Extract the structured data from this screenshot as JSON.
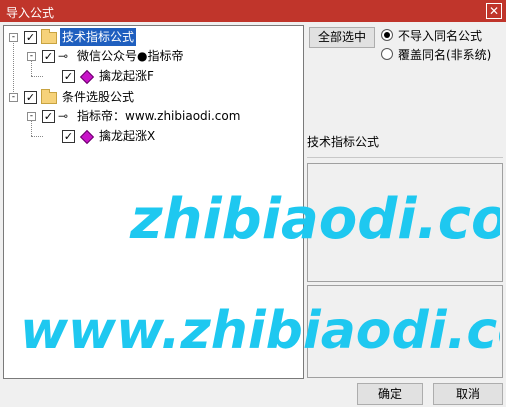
{
  "window": {
    "title": "导入公式",
    "close_glyph": "✕"
  },
  "tree": {
    "nodes": [
      {
        "label": "技术指标公式",
        "checked": true,
        "selected": true,
        "icon": "folder-icon"
      },
      {
        "label": "微信公众号●指标帝",
        "checked": true,
        "icon": "key-icon"
      },
      {
        "label": "擒龙起涨F",
        "checked": true,
        "icon": "formula-diamond-icon"
      },
      {
        "label": "条件选股公式",
        "checked": true,
        "icon": "folder-icon"
      },
      {
        "label": "指标帝：www.zhibiaodi.com",
        "checked": true,
        "icon": "key-icon"
      },
      {
        "label": "擒龙起涨X",
        "checked": true,
        "icon": "formula-diamond-icon"
      }
    ]
  },
  "options": {
    "select_all_label": "全部选中",
    "radio_no_import_label": "不导入同名公式",
    "radio_overwrite_label": "覆盖同名(非系统)",
    "selected": "no_import"
  },
  "info": {
    "category_label": "技术指标公式"
  },
  "footer": {
    "ok_label": "确定",
    "cancel_label": "取消"
  },
  "watermark": {
    "text_top": "zhibiaodi.com",
    "text_bottom": "www.zhibiaodi.com",
    "color": "#1ec8f0"
  },
  "colors": {
    "titlebar": "#c0352b",
    "selection": "#1f5fbf"
  }
}
